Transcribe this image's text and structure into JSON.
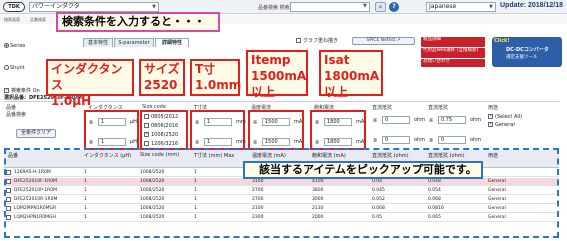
{
  "top": {
    "logo": "TDK",
    "category": "パワーインダクタ",
    "part_number_label": "品番検索 検索",
    "language": "Japanese",
    "update": "Update: 2018/12/18"
  },
  "subnav": [
    "検索画面",
    "品番検索",
    "比較表"
  ],
  "callout_top": "検索条件を入力すると・・・",
  "tabs": [
    "基本特性",
    "S-parameter",
    "詳細特性"
  ],
  "series_label": "Series",
  "shunt_label": "Shunt",
  "graph_label": "グラフ重ね描き",
  "spice_label": "SPICE Netlist",
  "red_buttons": [
    "製品詳細",
    "代用品Web遷移 (互換検索)",
    "お問い合わせ"
  ],
  "ad": {
    "click": "Click!",
    "line1": "DC-DCコンバータ",
    "line2": "選定支援ツール"
  },
  "param_callouts": [
    {
      "line1": "インダクタンス",
      "line2": "1.0μH"
    },
    {
      "line1": "サイズ",
      "line2": "2520"
    },
    {
      "line1": "T寸",
      "line2": "1.0mm"
    },
    {
      "line1": "Itemp",
      "line2": "1500mA",
      "line3": "以上"
    },
    {
      "line1": "Isat",
      "line2": "1800mA",
      "line3": "以上"
    }
  ],
  "filter_check": "検索条件 On",
  "selected_condition": "選択品番：DFE252010F-1R0M",
  "filters": {
    "pn_header": "品番",
    "pn_sub": "品番検索",
    "clear_all": "全条件クリア",
    "inductance": {
      "header": "インダクタンス",
      "min": "1",
      "max": "1",
      "unit": "μH"
    },
    "size": {
      "header": "Size code",
      "options": [
        "0805/2012",
        "0806/2016",
        "1008/2520",
        "1206/3216"
      ],
      "checked": [
        false,
        false,
        true,
        false
      ]
    },
    "t": {
      "header": "T寸法",
      "min": "1",
      "max": "1",
      "unit": "mm"
    },
    "itemp": {
      "header": "温度電流",
      "min": "1500",
      "max": "1500",
      "unit": "mA"
    },
    "isat": {
      "header": "飽和電流",
      "min": "1800",
      "max": "1800",
      "unit": "mA"
    },
    "rdc1": {
      "header": "直流抵抗",
      "min": "0",
      "max": "0",
      "unit": "ohm"
    },
    "rdc2": {
      "header": "直流抵抗",
      "min": "0.75",
      "max": "0",
      "unit": "ohm"
    },
    "usage": {
      "header": "用途",
      "options": [
        "(Select All)",
        "General"
      ]
    }
  },
  "results": {
    "headers": [
      "品番",
      "インダクタンス (μH)",
      "Size code (mm)",
      "T寸法 (mm) Max",
      "温度電流 (mA)",
      "飽和電流 (mA)",
      "直流抵抗 (ohm)",
      "直流抵抗 (ohm)",
      "用途"
    ],
    "rows": [
      [
        "1269AS-H-1R0M",
        "1",
        "1008/2520",
        "1",
        "",
        "",
        "",
        "",
        ""
      ],
      [
        "DFE252010F-1R0M",
        "1",
        "1008/2520",
        "1",
        "3100",
        "4100",
        "0.04",
        "0.048",
        "General"
      ],
      [
        "DFE252010P-1R0M",
        "1",
        "1008/2520",
        "1",
        "2700",
        "3800",
        "0.045",
        "0.054",
        "General"
      ],
      [
        "DFE252010R-1R0M",
        "1",
        "1008/2520",
        "1",
        "2700",
        "3000",
        "0.052",
        "0.068",
        "General"
      ],
      [
        "LQM2MPN1R0MGR",
        "1",
        "1008/2520",
        "1",
        "2100",
        "2130",
        "0.068",
        "0.0816",
        "General"
      ],
      [
        "LQM2HPN1R0MGH",
        "1",
        "1008/2520",
        "1",
        "2300",
        "2000",
        "0.05",
        "0.065",
        "General"
      ]
    ]
  },
  "bottom_callout": "該当するアイテムをピックアップ可能です。"
}
